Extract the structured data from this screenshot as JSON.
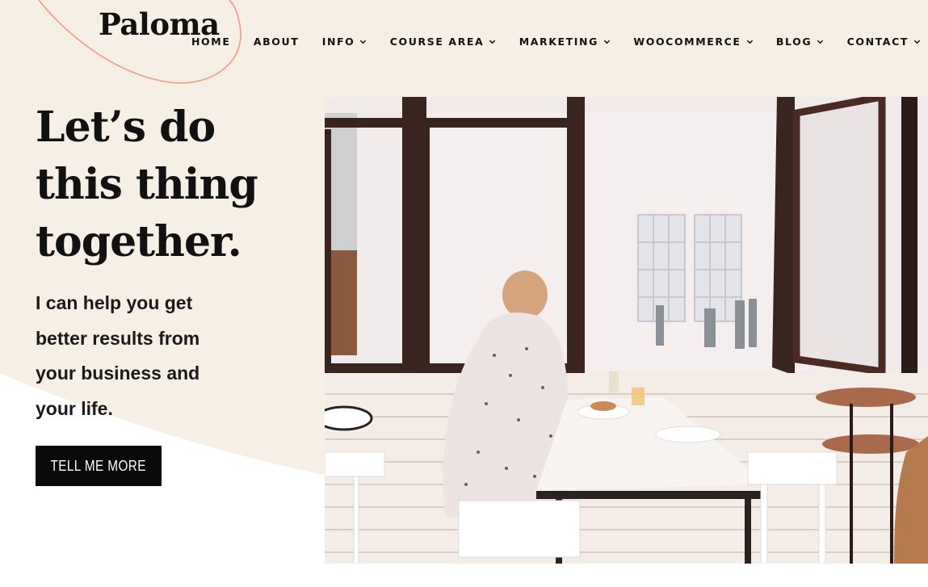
{
  "brand": {
    "logo_text": "Paloma",
    "accent_color": "#f19b80",
    "bg_color": "#f6efe6"
  },
  "nav": {
    "items": [
      {
        "label": "HOME",
        "dropdown": false
      },
      {
        "label": "ABOUT",
        "dropdown": false
      },
      {
        "label": "INFO",
        "dropdown": true
      },
      {
        "label": "COURSE AREA",
        "dropdown": true
      },
      {
        "label": "MARKETING",
        "dropdown": true
      },
      {
        "label": "WOOCOMMERCE",
        "dropdown": true
      },
      {
        "label": "BLOG",
        "dropdown": true
      },
      {
        "label": "CONTACT",
        "dropdown": true
      }
    ]
  },
  "hero": {
    "title_lines": [
      "Let’s do",
      "this thing",
      "together."
    ],
    "text_lines": [
      "I can help you get",
      "better results from",
      "your business and",
      "your life."
    ],
    "cta_label": "TELL ME MORE"
  }
}
